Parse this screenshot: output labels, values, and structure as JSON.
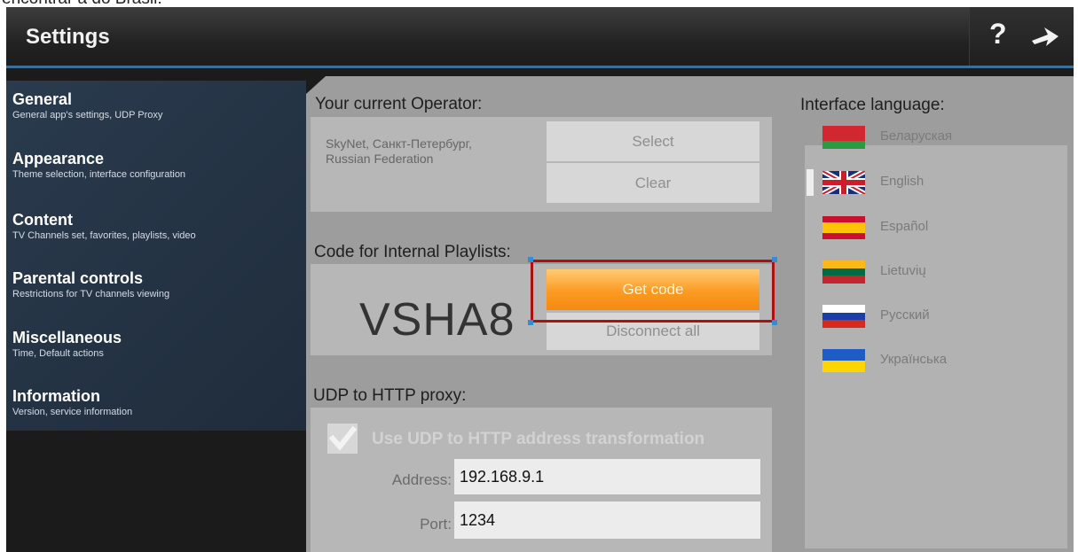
{
  "caption_fragment": "encontrar a do Brasil:",
  "header": {
    "title": "Settings"
  },
  "icons": {
    "help": "help-question-icon",
    "forward": "forward-arrow-icon"
  },
  "sidebar": {
    "items": [
      {
        "title": "General",
        "subtitle": "General app's settings, UDP Proxy"
      },
      {
        "title": "Appearance",
        "subtitle": "Theme selection, interface configuration"
      },
      {
        "title": "Content",
        "subtitle": "TV Channels set, favorites, playlists, video"
      },
      {
        "title": "Parental controls",
        "subtitle": "Restrictions for TV channels viewing"
      },
      {
        "title": "Miscellaneous",
        "subtitle": "Time, Default actions"
      },
      {
        "title": "Information",
        "subtitle": "Version, service information"
      }
    ]
  },
  "operator": {
    "label": "Your current Operator:",
    "value_line1": "SkyNet, Санкт-Петербург,",
    "value_line2": "Russian Federation",
    "select_label": "Select",
    "clear_label": "Clear"
  },
  "playlist_code": {
    "label": "Code for Internal Playlists:",
    "code": "VSHA8",
    "get_code_label": "Get code",
    "disconnect_label": "Disconnect all"
  },
  "udp_proxy": {
    "label": "UDP to HTTP proxy:",
    "checkbox_label": "Use UDP to HTTP address transformation",
    "checked": true,
    "address_label": "Address:",
    "address_value": "192.168.9.1",
    "port_label": "Port:",
    "port_value": "1234"
  },
  "language": {
    "label": "Interface language:",
    "selected": "English",
    "items": [
      {
        "name": "Беларуская",
        "flag": "belarus-flag-icon"
      },
      {
        "name": "English",
        "flag": "uk-flag-icon"
      },
      {
        "name": "Español",
        "flag": "spain-flag-icon"
      },
      {
        "name": "Lietuvių",
        "flag": "lithuania-flag-icon"
      },
      {
        "name": "Русский",
        "flag": "russia-flag-icon"
      },
      {
        "name": "Українська",
        "flag": "ukraine-flag-icon"
      }
    ]
  },
  "colors": {
    "accent": "#3f6f97",
    "primary_button": "#fb9a23",
    "highlight_box": "#ae0f0f"
  }
}
